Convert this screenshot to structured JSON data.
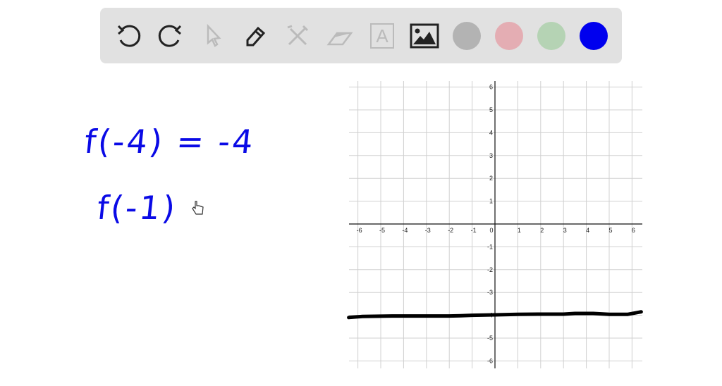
{
  "toolbar": {
    "tools": [
      {
        "name": "undo",
        "icon": "undo-icon"
      },
      {
        "name": "redo",
        "icon": "redo-icon"
      },
      {
        "name": "select",
        "icon": "pointer-icon"
      },
      {
        "name": "pen",
        "icon": "pencil-icon"
      },
      {
        "name": "tools",
        "icon": "tools-icon"
      },
      {
        "name": "eraser",
        "icon": "eraser-icon"
      },
      {
        "name": "text",
        "icon": "text-icon"
      },
      {
        "name": "image",
        "icon": "image-icon"
      }
    ],
    "text_tool_glyph": "A",
    "colors": [
      "#b3b3b3",
      "#e4adb3",
      "#b5d3b4",
      "#0000ee"
    ]
  },
  "board": {
    "line1": "f(-4) = -4",
    "line2": "f(-1)",
    "ink_color": "#0a0ae6"
  },
  "chart_data": {
    "type": "line",
    "x_ticks": [
      "-6",
      "-5",
      "-4",
      "-3",
      "-2",
      "-1",
      "0",
      "1",
      "2",
      "3",
      "4",
      "5",
      "6"
    ],
    "y_ticks": [
      "6",
      "5",
      "4",
      "3",
      "2",
      "1",
      "-1",
      "-2",
      "-3",
      "-4",
      "-5",
      "-6"
    ],
    "xlim": [
      -6.5,
      6.5
    ],
    "ylim": [
      -6.3,
      6.3
    ],
    "grid": true,
    "series": [
      {
        "name": "hand-drawn line",
        "x": [
          -6.4,
          -5.8,
          -4.5,
          -2,
          -1.5,
          -1,
          0,
          1,
          2,
          3,
          3.5,
          4.3,
          5,
          5.8,
          6.4
        ],
        "y": [
          -4.1,
          -4.05,
          -4.03,
          -4.03,
          -4.02,
          -4.0,
          -3.98,
          -3.96,
          -3.95,
          -3.95,
          -3.92,
          -3.92,
          -3.96,
          -3.96,
          -3.85
        ]
      }
    ]
  }
}
